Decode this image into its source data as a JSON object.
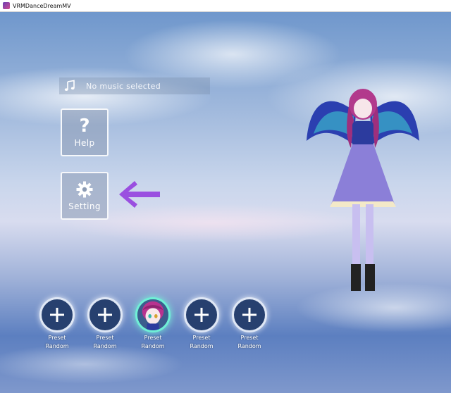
{
  "window": {
    "title": "VRMDanceDreamMV"
  },
  "music": {
    "status_text": "No music selected",
    "icon": "music-note-icon"
  },
  "menu": {
    "help": {
      "label": "Help",
      "icon": "question-mark-icon"
    },
    "setting": {
      "label": "Setting",
      "icon": "gear-icon"
    }
  },
  "indicator": {
    "icon": "arrow-left-icon",
    "color": "#9a4fe0"
  },
  "presets": [
    {
      "line1": "Preset",
      "line2": "Random",
      "icon": "plus-icon",
      "active": false
    },
    {
      "line1": "Preset",
      "line2": "Random",
      "icon": "plus-icon",
      "active": false
    },
    {
      "line1": "Preset",
      "line2": "Random",
      "icon": "character-avatar",
      "active": true
    },
    {
      "line1": "Preset",
      "line2": "Random",
      "icon": "plus-icon",
      "active": false
    },
    {
      "line1": "Preset",
      "line2": "Random",
      "icon": "plus-icon",
      "active": false
    }
  ],
  "colors": {
    "slot_fill": "#27406f",
    "active_ring": "#6ff0d6",
    "arrow": "#9a4fe0"
  }
}
